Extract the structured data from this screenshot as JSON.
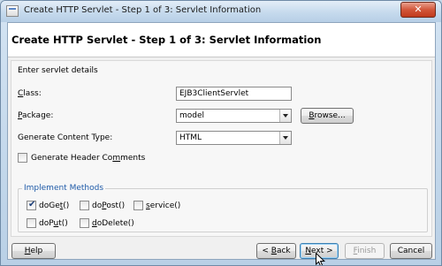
{
  "window": {
    "title": "Create HTTP Servlet - Step 1 of 3: Servlet Information",
    "close_symbol": "✕"
  },
  "header": {
    "title": "Create HTTP Servlet - Step 1 of 3: Servlet Information"
  },
  "form": {
    "intro": "Enter servlet details",
    "class": {
      "label_mnemonic": "C",
      "label_rest": "lass:",
      "value": "EJB3ClientServlet"
    },
    "package": {
      "label_mnemonic": "P",
      "label_rest": "ackage:",
      "value": "model",
      "browse_mnemonic": "B",
      "browse_rest": "rowse..."
    },
    "content_type": {
      "label": "Generate Content Type:",
      "value": "HTML"
    },
    "header_comments": {
      "label_before": "Generate Header Co",
      "label_mnemonic": "m",
      "label_after": "ments",
      "checked": false
    }
  },
  "methods": {
    "group_title": "Implement Methods",
    "items": [
      {
        "before": "doGe",
        "mnemonic": "t",
        "after": "()",
        "checked": true
      },
      {
        "before": "do",
        "mnemonic": "P",
        "after": "ost()",
        "checked": false
      },
      {
        "before": "",
        "mnemonic": "s",
        "after": "ervice()",
        "checked": false
      },
      {
        "before": "doP",
        "mnemonic": "u",
        "after": "t()",
        "checked": false
      },
      {
        "before": "",
        "mnemonic": "d",
        "after": "oDelete()",
        "checked": false
      }
    ]
  },
  "footer": {
    "help": {
      "mnemonic": "H",
      "rest": "elp"
    },
    "back": {
      "prefix": "< ",
      "mnemonic": "B",
      "rest": "ack"
    },
    "next": {
      "mnemonic": "N",
      "rest": "ext >"
    },
    "finish": {
      "mnemonic": "F",
      "rest": "inish"
    },
    "cancel": "Cancel"
  }
}
